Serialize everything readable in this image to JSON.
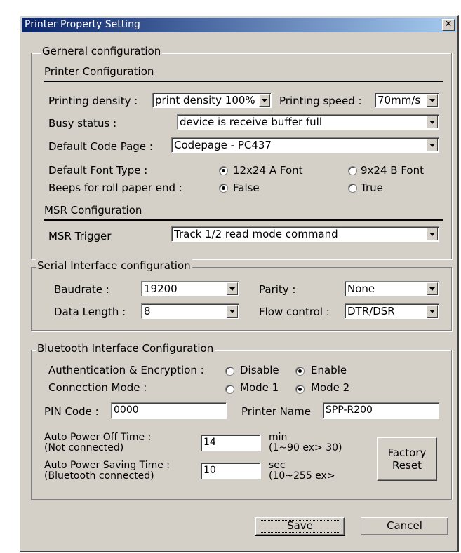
{
  "window": {
    "title": "Printer Property Setting",
    "close_label": "✕"
  },
  "general": {
    "group_title": "Gerneral configuration",
    "printer_config_title": "Printer Configuration",
    "printing_density_label": "Printing density :",
    "printing_density_value": "print density 100%",
    "printing_speed_label": "Printing speed :",
    "printing_speed_value": "70mm/s",
    "busy_status_label": "Busy status :",
    "busy_status_value": "device is receive buffer full",
    "code_page_label": "Default Code Page :",
    "code_page_value": "Codepage - PC437",
    "font_type_label": "Default Font Type :",
    "font_a_label": "12x24 A Font",
    "font_b_label": "9x24 B Font",
    "font_selected": "A",
    "beeps_label": "Beeps for roll paper end :",
    "beeps_false_label": "False",
    "beeps_true_label": "True",
    "beeps_selected": "False",
    "msr_config_title": "MSR Configuration",
    "msr_trigger_label": "MSR Trigger",
    "msr_trigger_value": "Track 1/2 read mode command"
  },
  "serial": {
    "group_title": "Serial Interface configuration",
    "baudrate_label": "Baudrate :",
    "baudrate_value": "19200",
    "parity_label": "Parity :",
    "parity_value": "None",
    "data_length_label": "Data Length :",
    "data_length_value": "8",
    "flow_control_label": "Flow control :",
    "flow_control_value": "DTR/DSR"
  },
  "bluetooth": {
    "group_title": "Bluetooth Interface Configuration",
    "auth_label": "Authentication & Encryption :",
    "auth_disable_label": "Disable",
    "auth_enable_label": "Enable",
    "auth_selected": "Enable",
    "conn_mode_label": "Connection Mode :",
    "mode1_label": "Mode 1",
    "mode2_label": "Mode 2",
    "conn_selected": "Mode 2",
    "pin_label": "PIN Code :",
    "pin_value": "0000",
    "printer_name_label": "Printer Name",
    "printer_name_value": "SPP-R200",
    "auto_off_label_1": "Auto Power Off Time :",
    "auto_off_label_2": "(Not connected)",
    "auto_off_value": "14",
    "auto_off_unit": "min",
    "auto_off_range": "(1~90 ex> 30)",
    "auto_save_label_1": "Auto Power Saving Time :",
    "auto_save_label_2": "(Bluetooth connected)",
    "auto_save_value": "10",
    "auto_save_unit": "sec",
    "auto_save_range": "(10~255 ex>",
    "factory_reset_label_1": "Factory",
    "factory_reset_label_2": "Reset"
  },
  "buttons": {
    "save_label": "Save",
    "cancel_label": "Cancel"
  }
}
